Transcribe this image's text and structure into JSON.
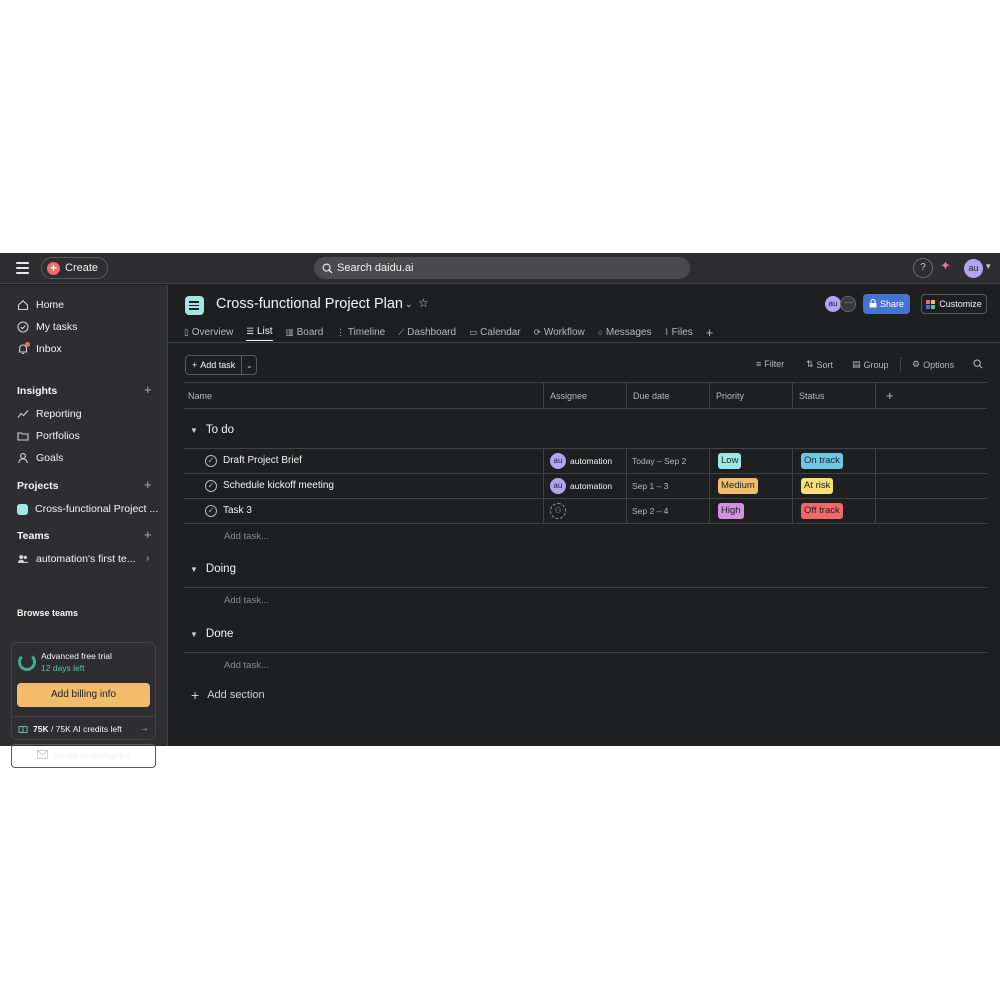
{
  "topbar": {
    "create_label": "Create",
    "search_placeholder": "Search daidu.ai",
    "help_label": "?",
    "avatar_initials": "au"
  },
  "sidebar": {
    "nav": [
      {
        "label": "Home",
        "icon": "home-icon"
      },
      {
        "label": "My tasks",
        "icon": "check-circle-icon"
      },
      {
        "label": "Inbox",
        "icon": "bell-icon"
      }
    ],
    "insights_heading": "Insights",
    "insights": [
      {
        "label": "Reporting",
        "icon": "chart-line-icon"
      },
      {
        "label": "Portfolios",
        "icon": "folder-icon"
      },
      {
        "label": "Goals",
        "icon": "person-icon"
      }
    ],
    "projects_heading": "Projects",
    "projects": [
      {
        "label": "Cross-functional Project ...",
        "color": "#9ee7e3"
      }
    ],
    "teams_heading": "Teams",
    "teams": [
      {
        "label": "automation's first te..."
      }
    ],
    "browse_teams": "Browse teams",
    "trial": {
      "title": "Advanced free trial",
      "days_left": "12 days left",
      "billing_button": "Add billing info",
      "credits_bold": "75K",
      "credits_rest": "/ 75K AI credits left"
    },
    "invite_button": "Invite teammates"
  },
  "project": {
    "title": "Cross-functional Project Plan",
    "avatar_initials": "au",
    "share_label": "Share",
    "customize_label": "Customize",
    "tabs": [
      {
        "label": "Overview",
        "icon": "overview-icon",
        "active": false
      },
      {
        "label": "List",
        "icon": "list-icon",
        "active": true
      },
      {
        "label": "Board",
        "icon": "board-icon",
        "active": false
      },
      {
        "label": "Timeline",
        "icon": "timeline-icon",
        "active": false
      },
      {
        "label": "Dashboard",
        "icon": "dashboard-icon",
        "active": false
      },
      {
        "label": "Calendar",
        "icon": "calendar-icon",
        "active": false
      },
      {
        "label": "Workflow",
        "icon": "workflow-icon",
        "active": false
      },
      {
        "label": "Messages",
        "icon": "message-icon",
        "active": false
      },
      {
        "label": "Files",
        "icon": "paperclip-icon",
        "active": false
      }
    ]
  },
  "toolbar": {
    "add_task": "Add task",
    "filter": "Filter",
    "sort": "Sort",
    "group": "Group",
    "options": "Options"
  },
  "table": {
    "columns": [
      "Name",
      "Assignee",
      "Due date",
      "Priority",
      "Status"
    ],
    "add_task_placeholder": "Add task...",
    "add_section": "Add section",
    "sections": [
      {
        "name": "To do",
        "tasks": [
          {
            "name": "Draft Project Brief",
            "assignee": "automation",
            "assignee_initials": "au",
            "due": "Today – Sep 2",
            "priority": "Low",
            "priority_color": "#9ee7e3",
            "status": "On track",
            "status_color": "#6fc7e8"
          },
          {
            "name": "Schedule kickoff meeting",
            "assignee": "automation",
            "assignee_initials": "au",
            "due": "Sep 1 – 3",
            "priority": "Medium",
            "priority_color": "#f1bd6c",
            "status": "At risk",
            "status_color": "#f8df72"
          },
          {
            "name": "Task 3",
            "assignee": "",
            "assignee_initials": "",
            "due": "Sep 2 – 4",
            "priority": "High",
            "priority_color": "#d291e3",
            "status": "Off track",
            "status_color": "#f06a6a"
          }
        ]
      },
      {
        "name": "Doing",
        "tasks": []
      },
      {
        "name": "Done",
        "tasks": []
      }
    ]
  }
}
